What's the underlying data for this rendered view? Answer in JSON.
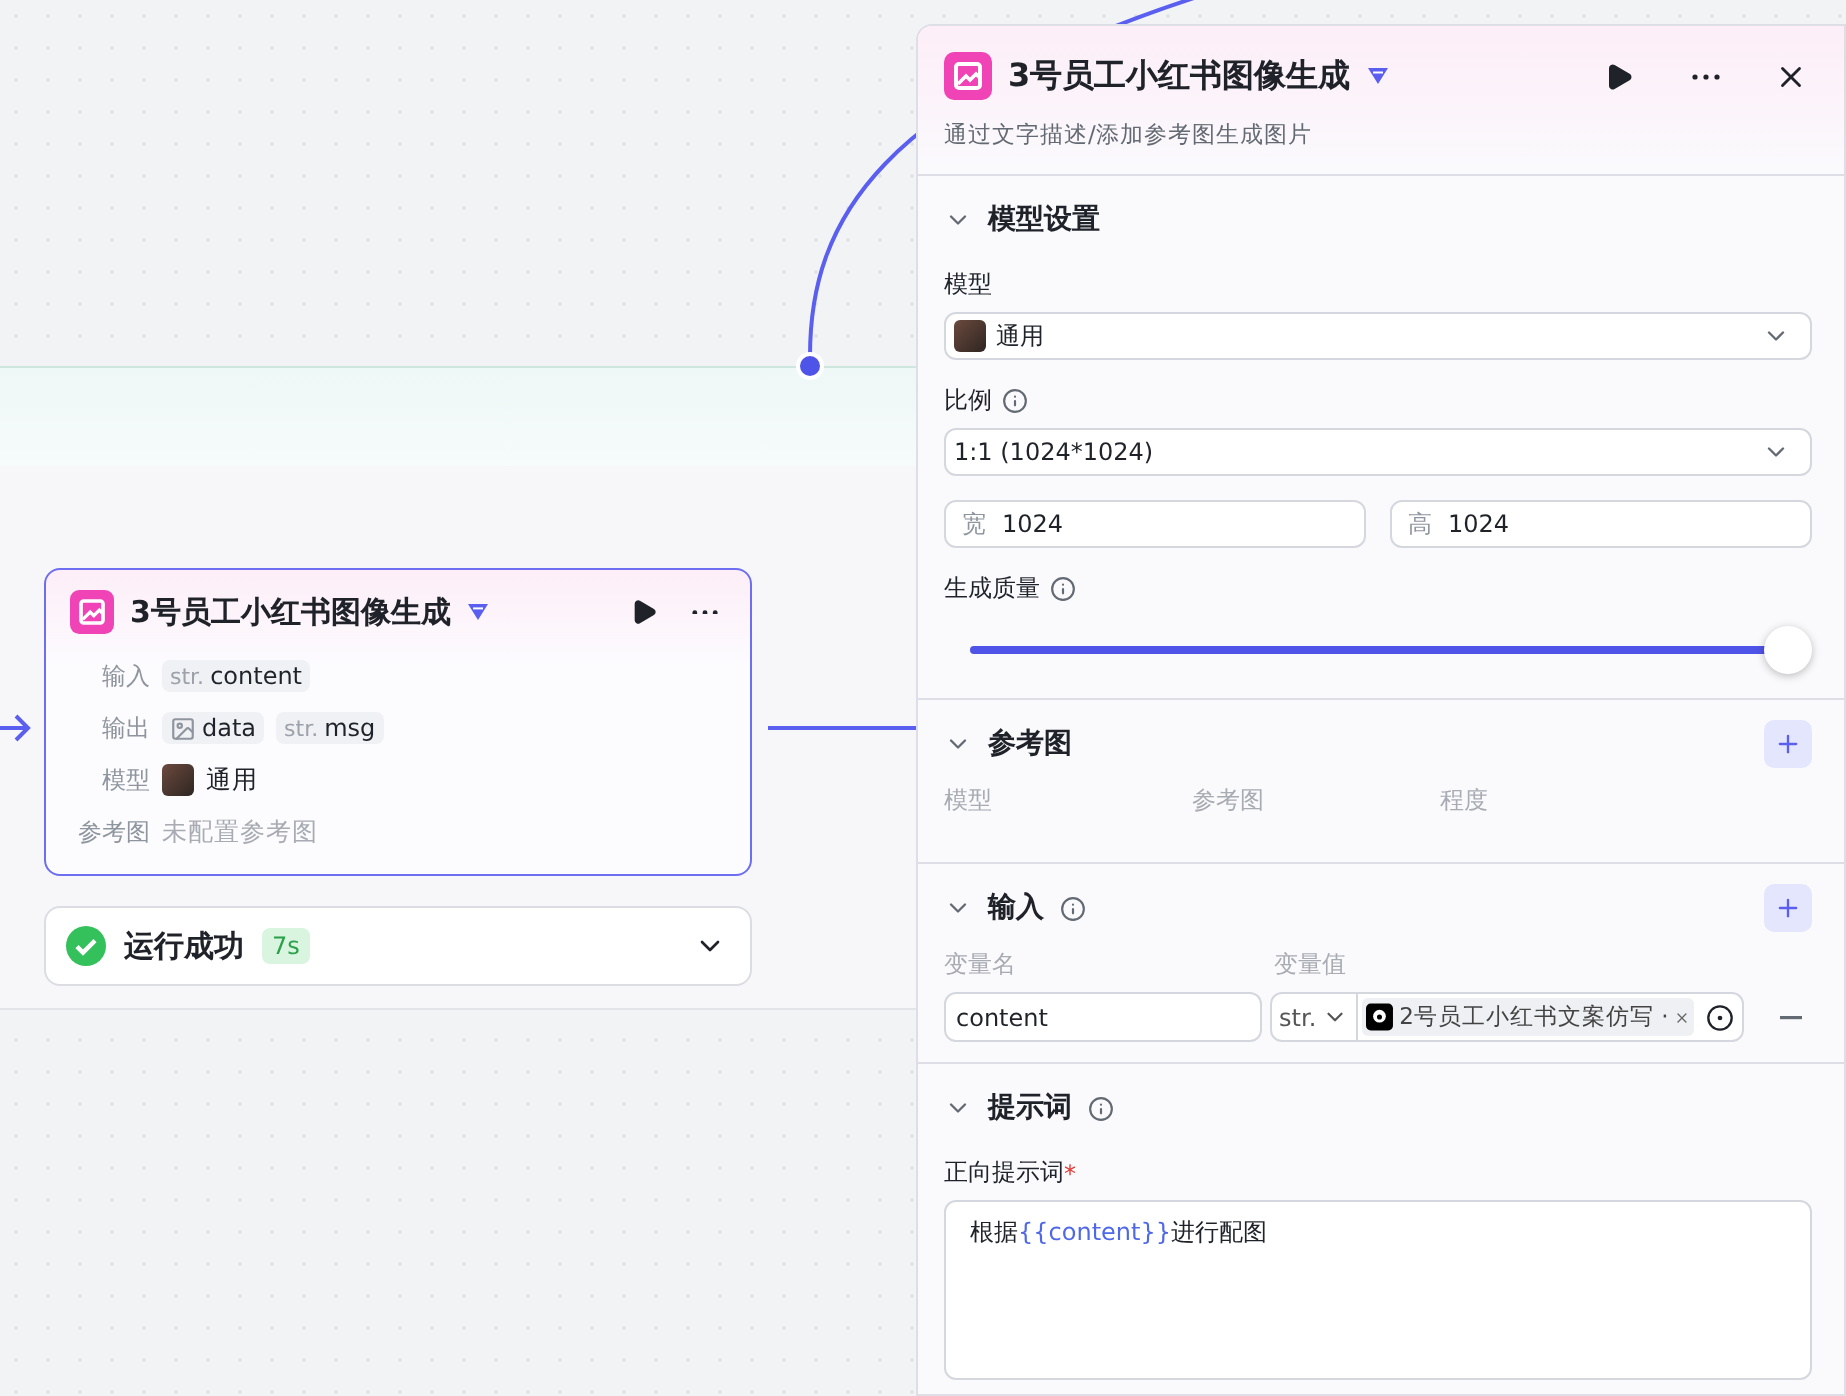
{
  "canvas": {
    "node": {
      "title": "3号员工小红书图像生成",
      "selected": true,
      "rows": [
        {
          "label": "输入",
          "kind": "chips",
          "chips": [
            {
              "kind": "string",
              "prefix": "str.",
              "name": "content"
            }
          ]
        },
        {
          "label": "输出",
          "kind": "chips",
          "chips": [
            {
              "kind": "image",
              "name": "data"
            },
            {
              "kind": "string",
              "prefix": "str.",
              "name": "msg"
            }
          ]
        },
        {
          "label": "模型",
          "kind": "model",
          "value": "通用"
        },
        {
          "label": "参考图",
          "kind": "empty",
          "value": "未配置参考图"
        }
      ]
    },
    "run_status": {
      "text": "运行成功",
      "duration": "7s",
      "success": true
    }
  },
  "panel": {
    "title": "3号员工小红书图像生成",
    "subtitle": "通过文字描述/添加参考图生成图片",
    "model_settings": {
      "title": "模型设置",
      "model_label": "模型",
      "model_value": "通用",
      "ratio_label": "比例",
      "ratio_value": "1:1 (1024*1024)",
      "width_label": "宽",
      "width_value": "1024",
      "height_label": "高",
      "height_value": "1024",
      "quality_label": "生成质量",
      "quality": {
        "level": 1
      }
    },
    "reference": {
      "title": "参考图",
      "columns": [
        "模型",
        "参考图",
        "程度"
      ]
    },
    "input": {
      "title": "输入",
      "columns": [
        "变量名",
        "变量值"
      ],
      "rows": [
        {
          "name": "content",
          "type": "str.",
          "reference": "2号员工小红书文案仿写 ·"
        }
      ]
    },
    "prompt": {
      "title": "提示词",
      "positive_label": "正向提示词",
      "required_mark": "*",
      "positive": {
        "before": "根据",
        "variable": "{{content}}",
        "after": "进行配图"
      }
    }
  }
}
